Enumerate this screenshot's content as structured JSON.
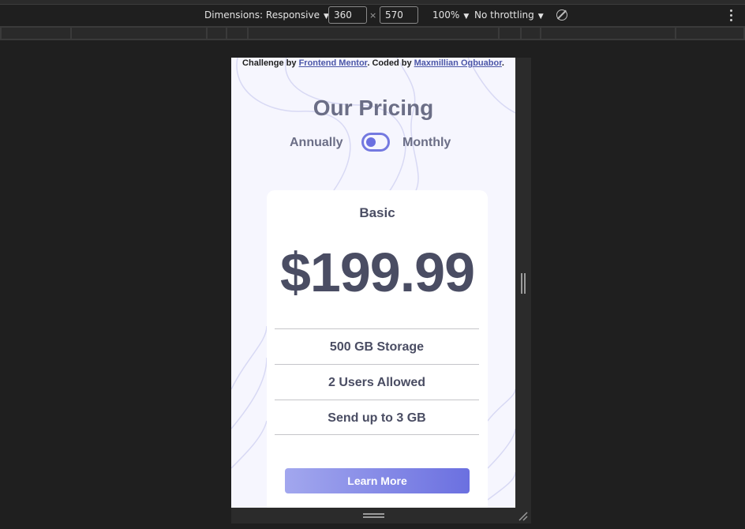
{
  "devtools": {
    "dimensions_label": "Dimensions: Responsive",
    "width": "360",
    "times": "×",
    "height": "570",
    "zoom": "100%",
    "throttling": "No throttling",
    "dropdown_caret": "▼"
  },
  "page": {
    "attribution_prefix": "Challenge by ",
    "attribution_link_1": "Frontend Mentor",
    "attribution_middle": ". Coded by ",
    "attribution_link_2": "Maxmillian Ogbuabor",
    "attribution_suffix": ".",
    "title": "Our Pricing",
    "toggle_left": "Annually",
    "toggle_right": "Monthly",
    "toggle_state": "annually"
  },
  "card": {
    "plan": "Basic",
    "price": "$199.99",
    "features": [
      "500 GB Storage",
      "2 Users Allowed",
      "Send up to 3 GB"
    ],
    "button": "Learn More"
  },
  "colors": {
    "accent": "#6b70e0",
    "accent_light": "#a2a7ee",
    "text": "#4a4d63",
    "muted": "#6b6e86",
    "background": "#f6f6fe",
    "link": "#4b56a8"
  }
}
